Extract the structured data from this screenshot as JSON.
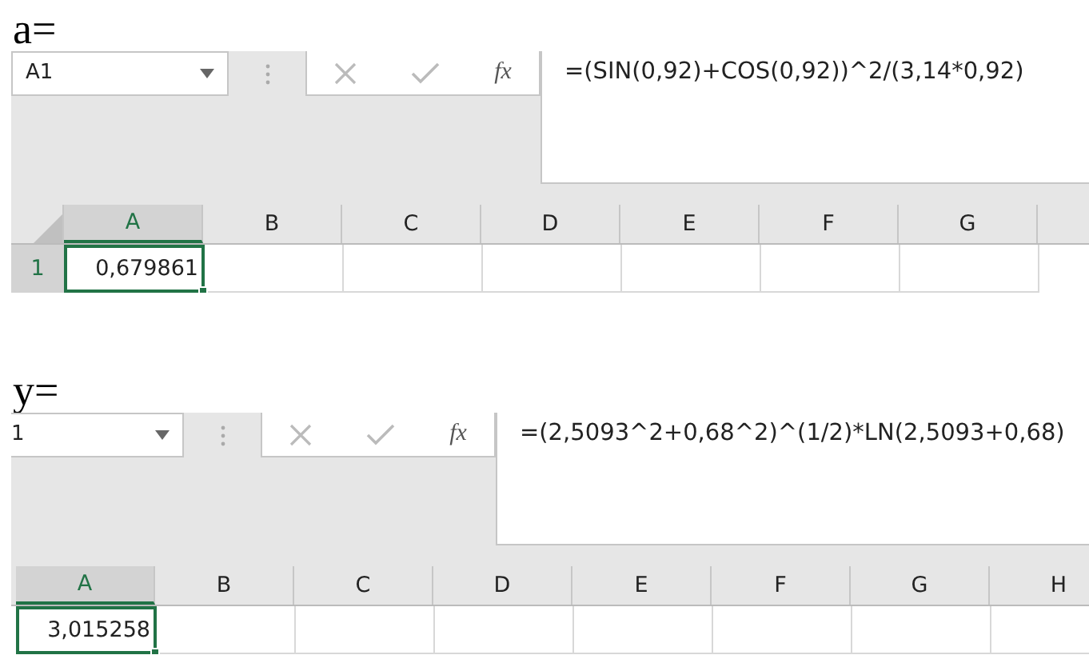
{
  "sheets": [
    {
      "label": "a=",
      "name_box": "A1",
      "fx": "fx",
      "formula": "=(SIN(0,92)+COS(0,92))^2/(3,14*0,92)",
      "row_header": {
        "text": "1",
        "selected": true
      },
      "columns": [
        {
          "text": "A",
          "selected": true
        },
        {
          "text": "B",
          "selected": false
        },
        {
          "text": "C",
          "selected": false
        },
        {
          "text": "D",
          "selected": false
        },
        {
          "text": "E",
          "selected": false
        },
        {
          "text": "F",
          "selected": false
        },
        {
          "text": "G",
          "selected": false
        }
      ],
      "cells": [
        "0,679861"
      ]
    },
    {
      "label": "y=",
      "name_box": "1",
      "fx": "fx",
      "formula": "=(2,5093^2+0,68^2)^(1/2)*LN(2,5093+0,68)",
      "columns": [
        {
          "text": "A",
          "selected": true
        },
        {
          "text": "B",
          "selected": false
        },
        {
          "text": "C",
          "selected": false
        },
        {
          "text": "D",
          "selected": false
        },
        {
          "text": "E",
          "selected": false
        },
        {
          "text": "F",
          "selected": false
        },
        {
          "text": "G",
          "selected": false
        },
        {
          "text": "H",
          "selected": false
        }
      ],
      "cells": [
        "3,015258"
      ]
    }
  ]
}
